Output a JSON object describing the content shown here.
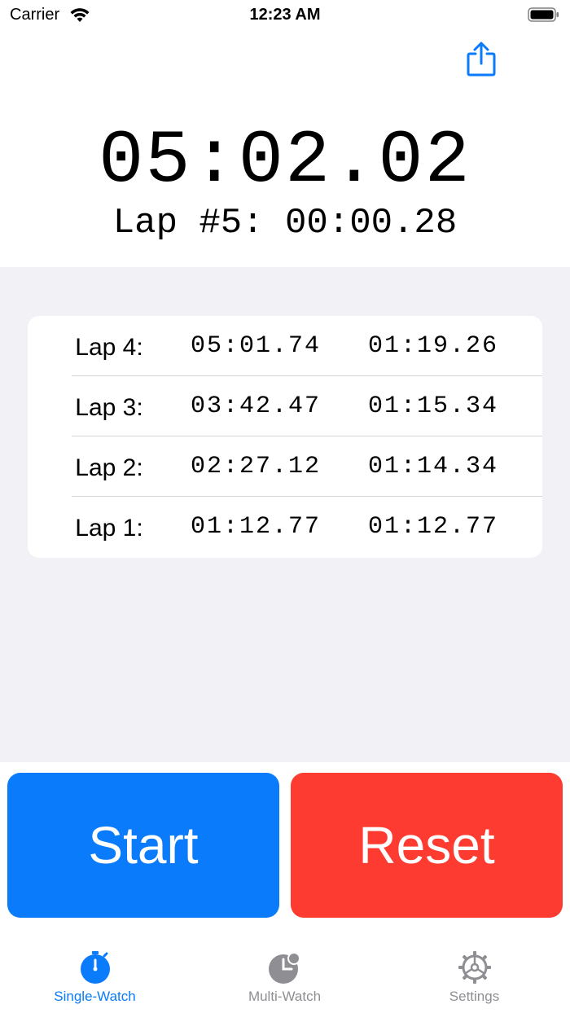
{
  "status_bar": {
    "carrier": "Carrier",
    "time": "12:23 AM"
  },
  "timer": {
    "main_time": "05:02.02",
    "current_lap": "Lap #5: 00:00.28"
  },
  "laps": [
    {
      "label": "Lap 4:",
      "total": "05:01.74",
      "split": "01:19.26"
    },
    {
      "label": "Lap 3:",
      "total": "03:42.47",
      "split": "01:15.34"
    },
    {
      "label": "Lap 2:",
      "total": "02:27.12",
      "split": "01:14.34"
    },
    {
      "label": "Lap 1:",
      "total": "01:12.77",
      "split": "01:12.77"
    }
  ],
  "buttons": {
    "start_label": "Start",
    "reset_label": "Reset"
  },
  "tabs": [
    {
      "label": "Single-Watch",
      "icon": "stopwatch-icon",
      "active": true
    },
    {
      "label": "Multi-Watch",
      "icon": "multi-clock-icon",
      "active": false
    },
    {
      "label": "Settings",
      "icon": "gear-icon",
      "active": false
    }
  ],
  "colors": {
    "accent": "#0a7bfb",
    "start": "#0a7bfb",
    "reset": "#fe3b30",
    "background": "#f1f1f6",
    "tab_inactive": "#8e8e93"
  }
}
